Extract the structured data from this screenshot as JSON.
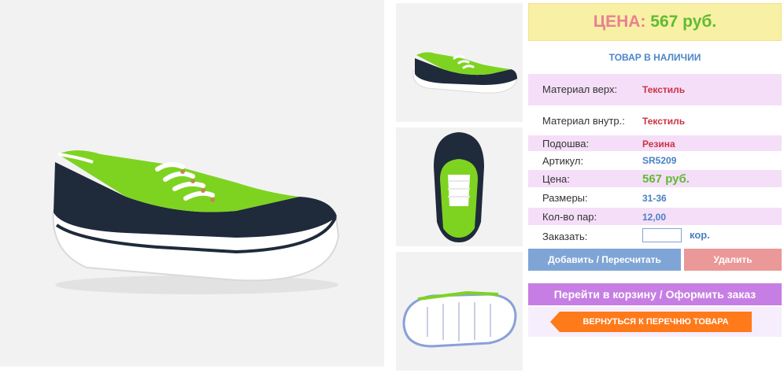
{
  "product": {
    "price_label": "ЦЕНА:",
    "price_value": "567 руб.",
    "stock_status": "ТОВАР В НАЛИЧИИ"
  },
  "specs": [
    {
      "label": "Материал верх:",
      "value": "Текстиль"
    },
    {
      "label": "Материал внутр.:",
      "value": "Текстиль"
    },
    {
      "label": "Подошва:",
      "value": "Резина"
    },
    {
      "label": "Артикул:",
      "value": "SR5209"
    },
    {
      "label": "Цена:",
      "value": "567 руб."
    },
    {
      "label": "Размеры:",
      "value": "31-36"
    },
    {
      "label": "Кол-во пар:",
      "value": "12,00"
    }
  ],
  "order": {
    "label": "Заказать:",
    "quantity_value": "",
    "unit": "кор."
  },
  "buttons": {
    "add_label": "Добавить / Пересчитать",
    "delete_label": "Удалить",
    "cart_label": "Перейти в корзину / Оформить заказ",
    "back_label": "ВЕРНУТЬСЯ К ПЕРЕЧНЮ ТОВАРА"
  },
  "colors": {
    "price_bg": "#f8f0a4",
    "price_label": "#e98090",
    "price_value": "#5fbb32",
    "stock": "#4d86c7",
    "spec_row_bg": "#f5def8",
    "add_button": "#7fa5d6",
    "delete_button": "#eb9898",
    "cart_button": "#c77ee4",
    "back_button": "#ff7a1a",
    "shoe_green": "#7ed321",
    "shoe_navy": "#1f2a3a"
  },
  "images": {
    "main": "shoe-side-view",
    "thumbnails": [
      "shoe-side-view",
      "shoe-top-view",
      "shoe-sole-view"
    ]
  }
}
